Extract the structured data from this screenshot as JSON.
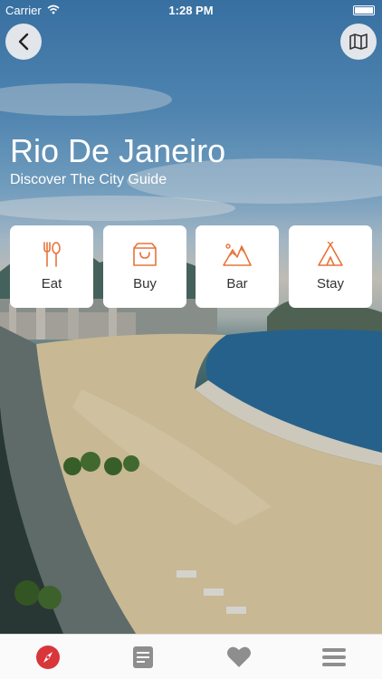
{
  "status_bar": {
    "carrier": "Carrier",
    "time": "1:28 PM"
  },
  "header": {
    "title": "Rio De Janeiro",
    "subtitle": "Discover The City Guide"
  },
  "categories": [
    {
      "label": "Eat",
      "icon": "fork-spoon-icon"
    },
    {
      "label": "Buy",
      "icon": "shopping-bag-icon"
    },
    {
      "label": "Bar",
      "icon": "mountains-icon"
    },
    {
      "label": "Stay",
      "icon": "tent-icon"
    }
  ],
  "tabs": [
    {
      "name": "compass-icon",
      "active": true
    },
    {
      "name": "document-icon",
      "active": false
    },
    {
      "name": "heart-icon",
      "active": false
    },
    {
      "name": "menu-icon",
      "active": false
    }
  ],
  "colors": {
    "accent": "#e8733a",
    "active_tab": "#d8363a",
    "inactive_tab": "#8e8e8e"
  }
}
